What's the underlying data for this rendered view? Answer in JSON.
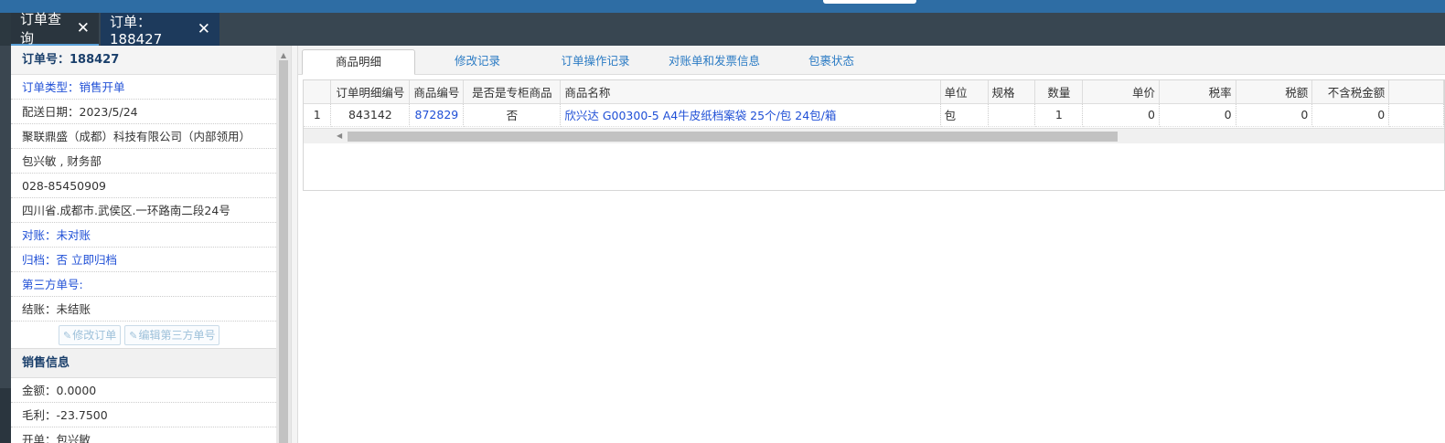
{
  "tabs": [
    {
      "label": "订单查询"
    },
    {
      "label": "订单：188427"
    }
  ],
  "left_panel": {
    "order_no": "订单号：188427",
    "rows": [
      {
        "label": "订单类型：",
        "value": "销售开单",
        "blue": true
      },
      {
        "label": "配送日期：",
        "value": "2023/5/24"
      },
      {
        "label": "",
        "value": "聚联鼎盛（成都）科技有限公司（内部领用）"
      },
      {
        "label": "",
        "value": "包兴敏 , 财务部"
      },
      {
        "label": "",
        "value": "028-85450909"
      },
      {
        "label": "",
        "value": "四川省.成都市.武侯区.一环路南二段24号"
      },
      {
        "label": "对账：",
        "value": "未对账",
        "blue": true
      },
      {
        "label": "归档：",
        "value": "否 立即归档",
        "blue": true
      },
      {
        "label": "第三方单号:",
        "value": "",
        "blue": true
      },
      {
        "label": "结账：",
        "value": "未结账"
      }
    ],
    "buttons": {
      "edit_order": "修改订单",
      "edit_third_party": "编辑第三方单号"
    },
    "sales_section_title": "销售信息",
    "sales_rows": [
      {
        "label": "金额：",
        "value": "0.0000"
      },
      {
        "label": "毛利：",
        "value": "-23.7500"
      },
      {
        "label": "开单：",
        "value": "包兴敏"
      }
    ]
  },
  "subtabs": [
    {
      "label": "商品明细",
      "active": true
    },
    {
      "label": "修改记录"
    },
    {
      "label": "订单操作记录"
    },
    {
      "label": "对账单和发票信息"
    },
    {
      "label": "包裹状态"
    }
  ],
  "grid": {
    "columns": [
      "",
      "订单明细编号",
      "商品编号",
      "是否是专柜商品",
      "商品名称",
      "单位",
      "规格",
      "数量",
      "单价",
      "税率",
      "税额",
      "不含税金额"
    ],
    "rows": [
      [
        "1",
        "843142",
        "872829",
        "否",
        "欣兴达 G00300-5 A4牛皮纸档案袋 25个/包 24包/箱",
        "包",
        "",
        "1",
        "0",
        "0",
        "0",
        "0"
      ]
    ]
  },
  "colors": {
    "topbar": "#2e6da4",
    "tabbar": "#384651",
    "link": "#1f4fd6",
    "subtab_link": "#2b7bc4"
  }
}
